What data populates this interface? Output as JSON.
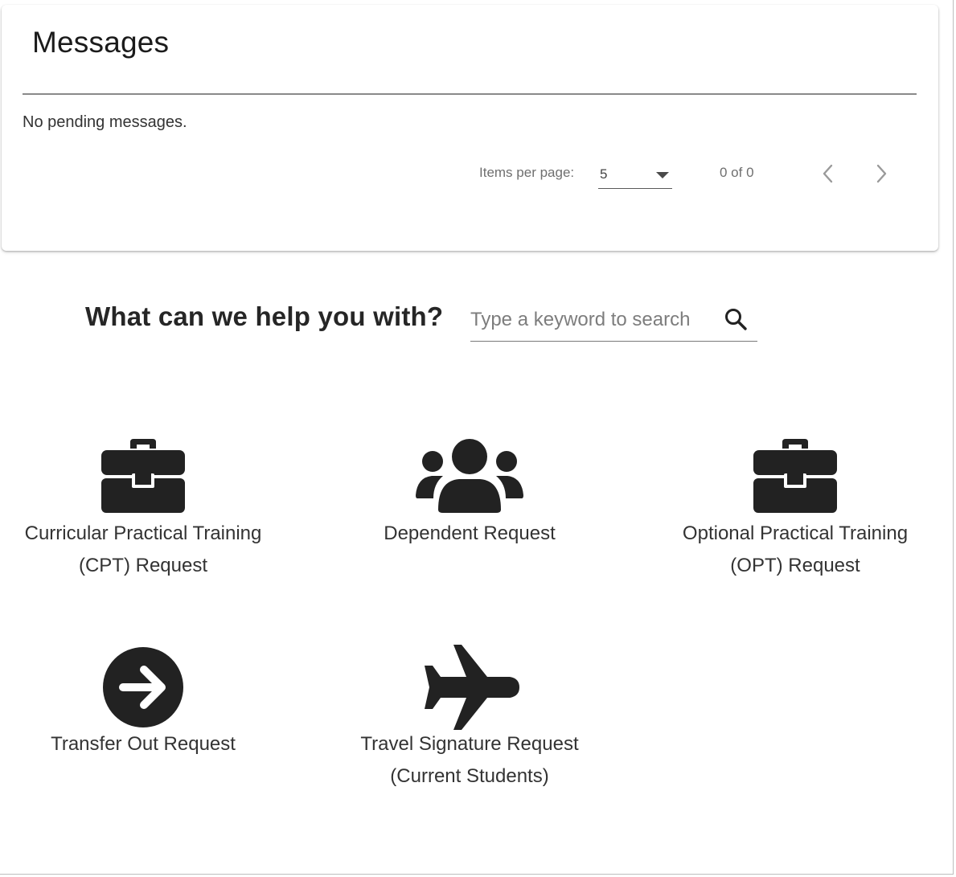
{
  "messages": {
    "title": "Messages",
    "empty_text": "No pending messages.",
    "paginator": {
      "items_per_page_label": "Items per page:",
      "page_size": "5",
      "range_label": "0 of 0",
      "prev_icon": "chevron-left-icon",
      "next_icon": "chevron-right-icon"
    }
  },
  "help": {
    "heading": "What can we help you with?",
    "search_placeholder": "Type a keyword to search",
    "search_icon": "search-icon"
  },
  "services": [
    {
      "icon": "briefcase-icon",
      "line1": "Curricular Practical Training",
      "line2": "(CPT) Request"
    },
    {
      "icon": "users-icon",
      "line1": "Dependent Request",
      "line2": ""
    },
    {
      "icon": "briefcase-icon",
      "line1": "Optional Practical Training",
      "line2": "(OPT) Request"
    },
    {
      "icon": "arrow-circle-right-icon",
      "line1": "Transfer Out Request",
      "line2": ""
    },
    {
      "icon": "plane-icon",
      "line1": "Travel Signature Request",
      "line2": "(Current Students)"
    }
  ],
  "colors": {
    "icon": "#222222",
    "text": "#333333",
    "muted": "#6f6f6f",
    "divider": "#8a8a8a"
  }
}
